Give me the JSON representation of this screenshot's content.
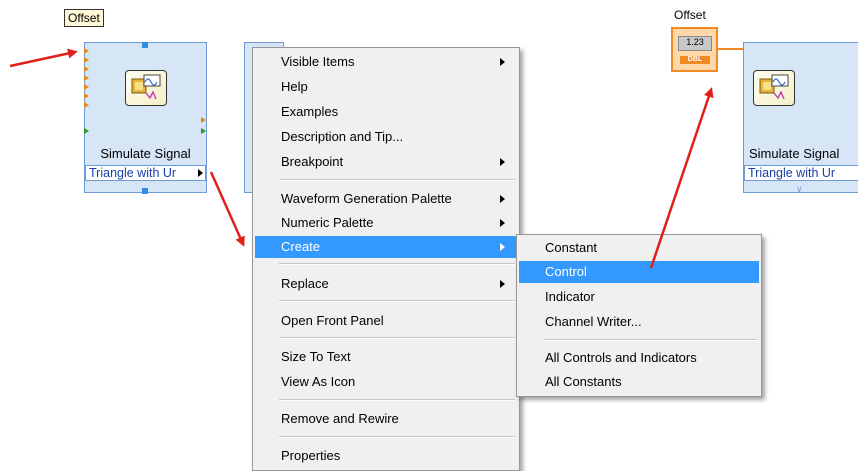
{
  "left_node": {
    "offset_label": "Offset",
    "title": "Simulate Signal",
    "input_value": "Triangle with Ur"
  },
  "right_node": {
    "offset_label": "Offset",
    "control_value": "1.23",
    "control_type": "DBL",
    "title": "Simulate Signal",
    "input_value": "Triangle with Ur"
  },
  "context_menu": {
    "items": [
      {
        "label": "Visible Items",
        "submenu": true
      },
      {
        "label": "Help"
      },
      {
        "label": "Examples"
      },
      {
        "label": "Description and Tip..."
      },
      {
        "label": "Breakpoint",
        "submenu": true
      },
      {
        "label": "Waveform Generation Palette",
        "submenu": true
      },
      {
        "label": "Numeric Palette",
        "submenu": true
      },
      {
        "label": "Create",
        "submenu": true,
        "highlighted": true
      },
      {
        "label": "Replace",
        "submenu": true
      },
      {
        "label": "Open Front Panel"
      },
      {
        "label": "Size To Text"
      },
      {
        "label": "View As Icon"
      },
      {
        "label": "Remove and Rewire"
      },
      {
        "label": "Properties"
      }
    ]
  },
  "create_submenu": {
    "items": [
      {
        "label": "Constant"
      },
      {
        "label": "Control",
        "highlighted": true
      },
      {
        "label": "Indicator"
      },
      {
        "label": "Channel Writer..."
      },
      {
        "label": "All Controls and Indicators"
      },
      {
        "label": "All Constants"
      }
    ]
  },
  "colors": {
    "annotation_arrow": "#e0201b",
    "highlight": "#3399ff",
    "node_fill": "#d6e6f7",
    "node_border": "#6f9ad4",
    "control_orange": "#f08a24"
  }
}
